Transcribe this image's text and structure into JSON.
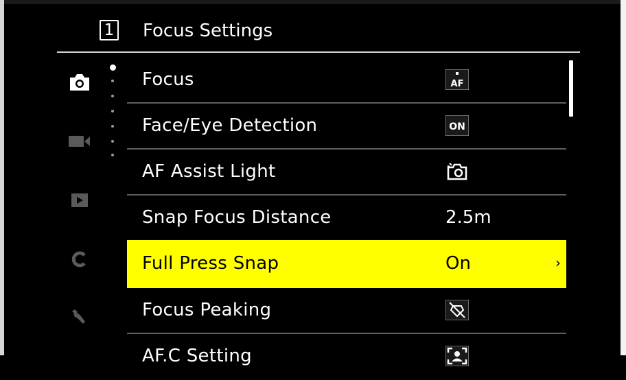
{
  "header": {
    "page_number": "1",
    "title": "Focus Settings"
  },
  "sidebar": {
    "icons": [
      "camera-icon",
      "video-camera-icon",
      "playback-icon",
      "custom-c-icon",
      "wrench-icon"
    ],
    "page_dots": 6,
    "active_dot": 1
  },
  "menu": {
    "items": [
      {
        "label": "Focus",
        "value": "",
        "value_icon": "af-mode-icon"
      },
      {
        "label": "Face/Eye Detection",
        "value": "ON",
        "value_icon": "on-badge-icon"
      },
      {
        "label": "AF Assist Light",
        "value": "",
        "value_icon": "af-assist-lamp-icon"
      },
      {
        "label": "Snap Focus Distance",
        "value": "2.5m",
        "value_icon": ""
      },
      {
        "label": "Full Press Snap",
        "value": "On",
        "value_icon": "",
        "selected": true,
        "chevron": "›"
      },
      {
        "label": "Focus Peaking",
        "value": "",
        "value_icon": "peaking-off-icon"
      },
      {
        "label": "AF.C Setting",
        "value": "",
        "value_icon": "afc-subject-icon"
      }
    ]
  },
  "icon_values": {
    "af_text": "AF"
  },
  "scrollbar": {
    "position": 0,
    "visible_fraction": 0.2
  },
  "colors": {
    "background": "#000000",
    "selected_row": "#ffff00",
    "text": "#ffffff",
    "selected_text": "#000000"
  }
}
